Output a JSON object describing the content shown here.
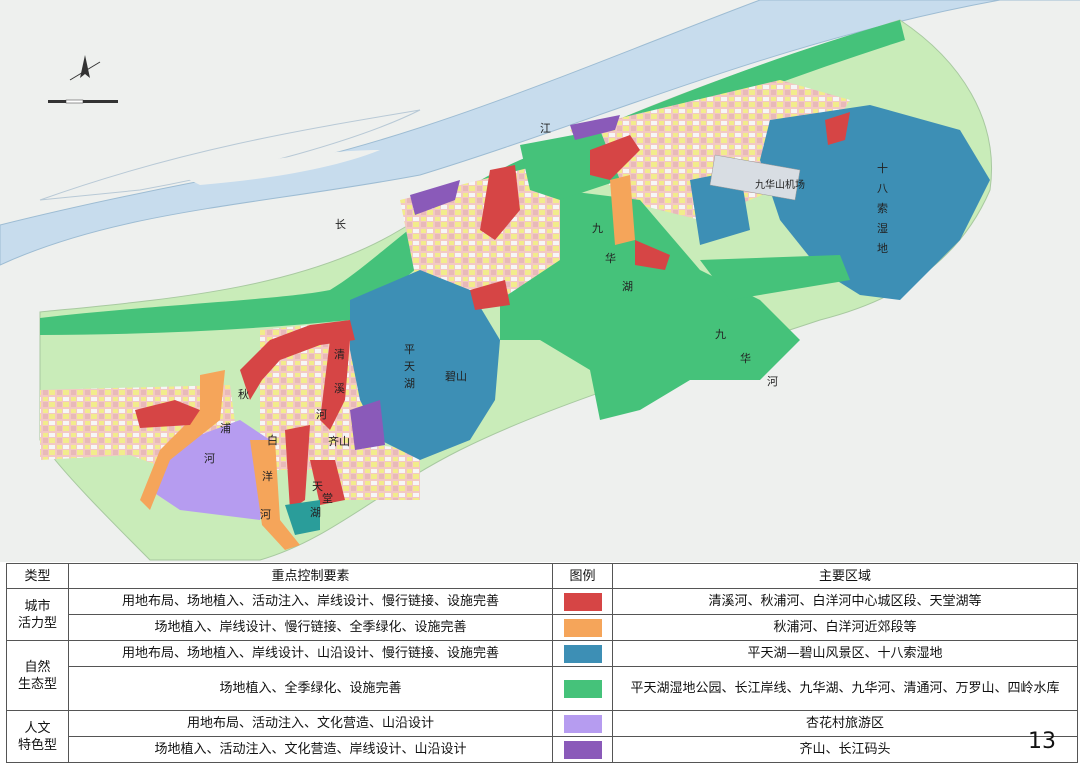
{
  "colors": {
    "vitality": "#d64545",
    "vitality_light": "#f5a55a",
    "eco_blue": "#3d8fb5",
    "eco_green": "#45c27a",
    "culture_light": "#b69cf0",
    "culture_dark": "#8a5ab9",
    "river": "#c7dced",
    "base": "#eef0ee",
    "urban_green": "#c9ecb9"
  },
  "map": {
    "icons": [
      "north-arrow-icon",
      "scale-bar-icon"
    ],
    "labels": {
      "yangtze_1": "长",
      "yangtze_2": "江",
      "jiuhuashan_airport": "九华山机场",
      "shibasuo_1": "十",
      "shibasuo_2": "八",
      "shibasuo_3": "索",
      "shibasuo_4": "湿",
      "shibasuo_5": "地",
      "jiuhuahu_1": "九",
      "jiuhuahu_2": "华",
      "jiuhuahu_3": "湖",
      "jiuhuahe_1": "九",
      "jiuhuahe_2": "华",
      "jiuhuahe_3": "河",
      "pingtianhu_1": "平",
      "pingtianhu_2": "天",
      "pingtianhu_3": "湖",
      "bishan": "碧山",
      "qishan": "齐山",
      "qiupu_1": "秋",
      "qiupu_2": "浦",
      "qiupu_3": "河",
      "baiyang_1": "白",
      "baiyang_2": "洋",
      "baiyang_3": "河",
      "qingxi_1": "清",
      "qingxi_2": "溪",
      "qingxi_3": "河",
      "tiantang_1": "天",
      "tiantang_2": "堂",
      "tiantang_3": "湖"
    }
  },
  "table": {
    "headers": [
      "类型",
      "重点控制要素",
      "图例",
      "主要区域"
    ],
    "groups": [
      {
        "type": "城市活力型",
        "rows": [
          {
            "elements": "用地布局、场地植入、活动注入、岸线设计、慢行链接、设施完善",
            "color": "#d64545",
            "areas": "清溪河、秋浦河、白洋河中心城区段、天堂湖等"
          },
          {
            "elements": "场地植入、岸线设计、慢行链接、全季绿化、设施完善",
            "color": "#f5a55a",
            "areas": "秋浦河、白洋河近郊段等"
          }
        ]
      },
      {
        "type": "自然生态型",
        "rows": [
          {
            "elements": "用地布局、场地植入、岸线设计、山沿设计、慢行链接、设施完善",
            "color": "#3d8fb5",
            "areas": "平天湖—碧山风景区、十八索湿地"
          },
          {
            "elements": "场地植入、全季绿化、设施完善",
            "color": "#45c27a",
            "areas": "平天湖湿地公园、长江岸线、九华湖、九华河、清通河、万罗山、四岭水库"
          }
        ]
      },
      {
        "type": "人文特色型",
        "rows": [
          {
            "elements": "用地布局、活动注入、文化营造、山沿设计",
            "color": "#b69cf0",
            "areas": "杏花村旅游区"
          },
          {
            "elements": "场地植入、活动注入、文化营造、岸线设计、山沿设计",
            "color": "#8a5ab9",
            "areas": "齐山、长江码头"
          }
        ]
      }
    ]
  },
  "page_number": "13"
}
